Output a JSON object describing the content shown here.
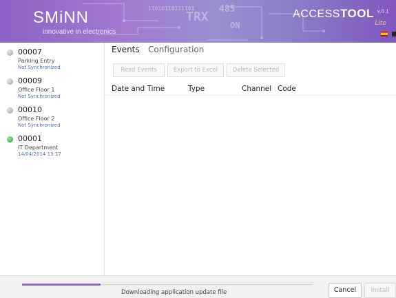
{
  "header": {
    "logo": "SMiNN",
    "tagline": "innovative in electronics",
    "app_title_light": "ACCESS",
    "app_title_bold": "TOOL",
    "version": "v.0.1",
    "edition": "Lite",
    "watermark_trx": "TRX",
    "watermark_num": "485",
    "watermark_on": "ON",
    "watermark_bits": "11010110111101",
    "language_flags": [
      "flag-spain-icon",
      "flag-other-icon"
    ]
  },
  "devices": [
    {
      "id": "00007",
      "name": "Parking Entry",
      "status": "Not Synchronized",
      "indicator": "gray"
    },
    {
      "id": "00009",
      "name": "Office Floor 1",
      "status": "Not Synchronized",
      "indicator": "gray"
    },
    {
      "id": "00010",
      "name": "Office Floor 2",
      "status": "Not Synchronized",
      "indicator": "gray"
    },
    {
      "id": "00001",
      "name": "IT Department",
      "status": "14/04/2014 13:17",
      "indicator": "green"
    }
  ],
  "tabs": [
    {
      "label": "Events",
      "active": true
    },
    {
      "label": "Configuration",
      "active": false
    }
  ],
  "toolbar": {
    "read_events": "Read Events",
    "export_excel": "Export to Excel",
    "delete_selected": "Delete Selected"
  },
  "table": {
    "columns": [
      "Date and Time",
      "Type",
      "Channel",
      "Code"
    ],
    "rows": []
  },
  "footer": {
    "progress": 0.27,
    "status_text": "Downloading application update file",
    "cancel_label": "Cancel",
    "install_label": "Install"
  },
  "colors": {
    "brand_purple": "#8a63c4",
    "link_blue": "#4a6fb0",
    "online_green": "#2a9a2a"
  }
}
